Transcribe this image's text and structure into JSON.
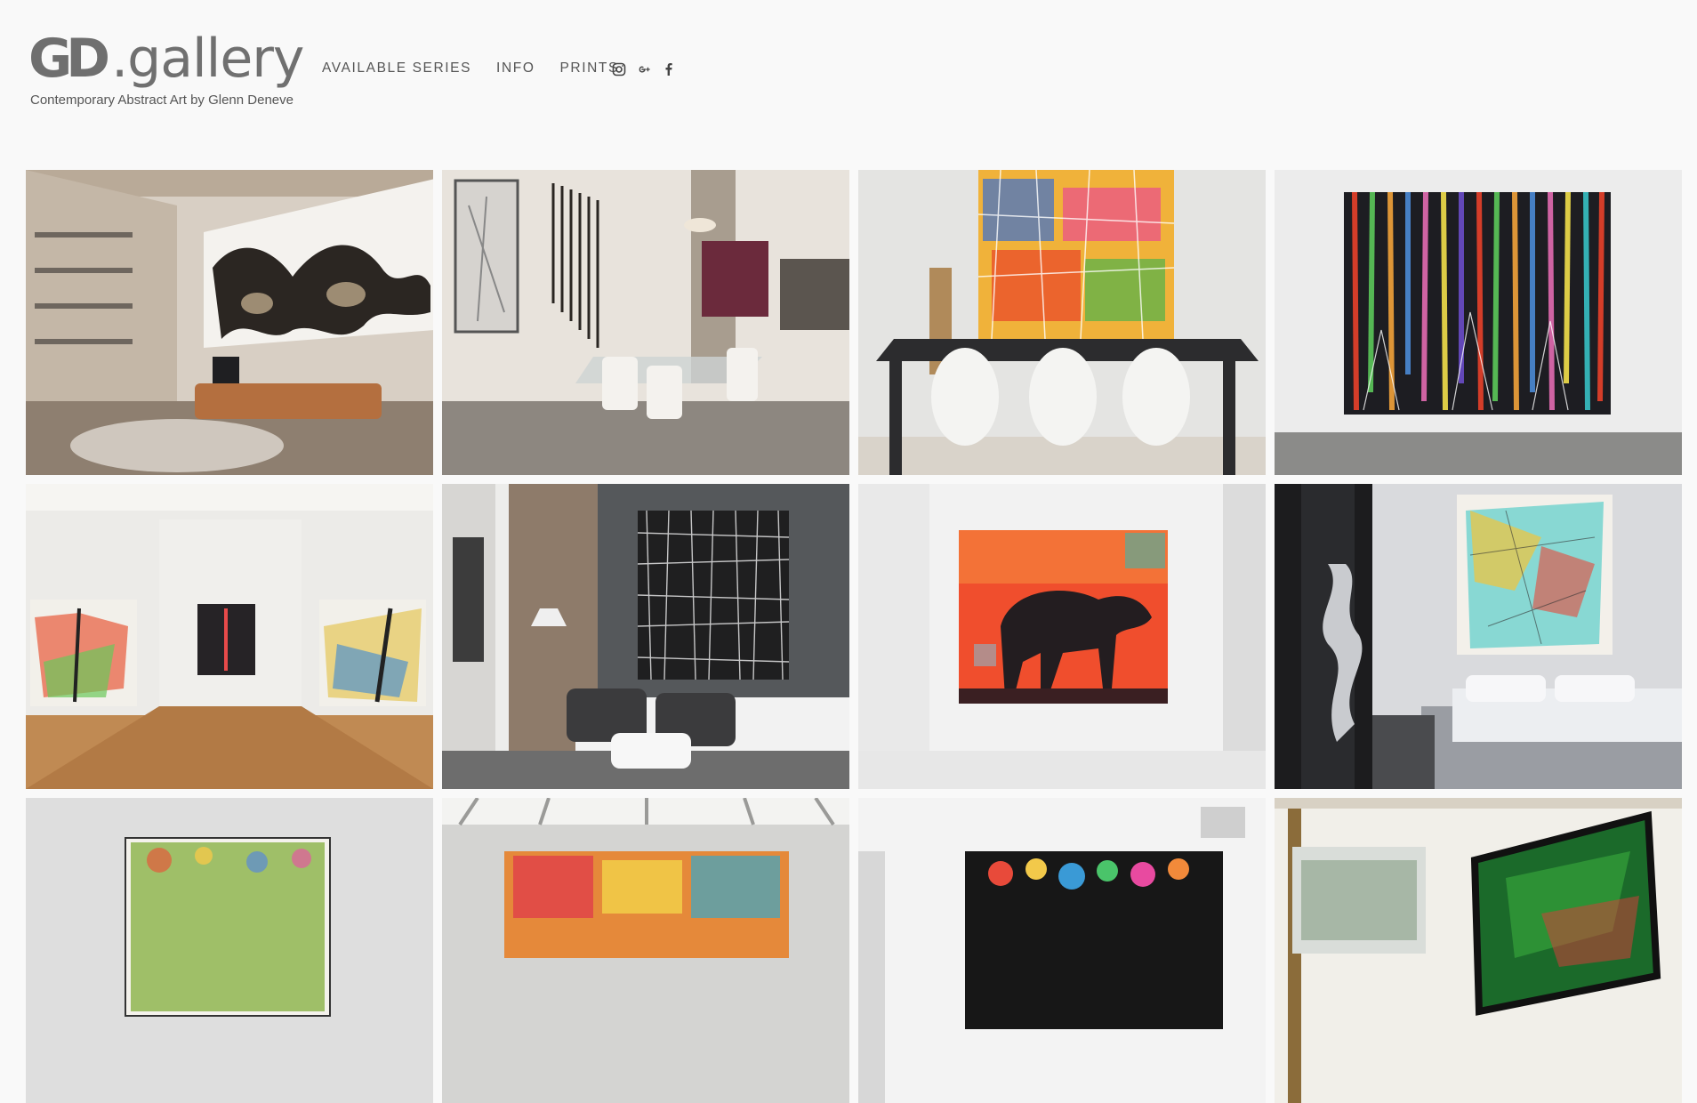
{
  "site": {
    "logo_mark": "GD",
    "logo_text": ".gallery",
    "tagline": "Contemporary Abstract Art by Glenn Deneve"
  },
  "nav": {
    "items": [
      "AVAILABLE SERIES",
      "INFO",
      "PRINTS"
    ]
  },
  "social": [
    "instagram-icon",
    "google-plus-icon",
    "facebook-icon"
  ],
  "gallery": {
    "tiles": [
      {
        "scene": "living room with black and white organic painting"
      },
      {
        "scene": "dining room with grey and magenta paintings"
      },
      {
        "scene": "dining table with colorful abstract painting"
      },
      {
        "scene": "colorful drip painting on white wall"
      },
      {
        "scene": "gallery with three colorful paintings"
      },
      {
        "scene": "bedroom with black and white grid painting"
      },
      {
        "scene": "red bull painting Seville"
      },
      {
        "scene": "bedroom with turquoise and yellow painting"
      },
      {
        "scene": "green abstract painting in room"
      },
      {
        "scene": "skylight room with colorful painting"
      },
      {
        "scene": "room with colorful splatter painting"
      },
      {
        "scene": "room with green painting"
      }
    ]
  }
}
